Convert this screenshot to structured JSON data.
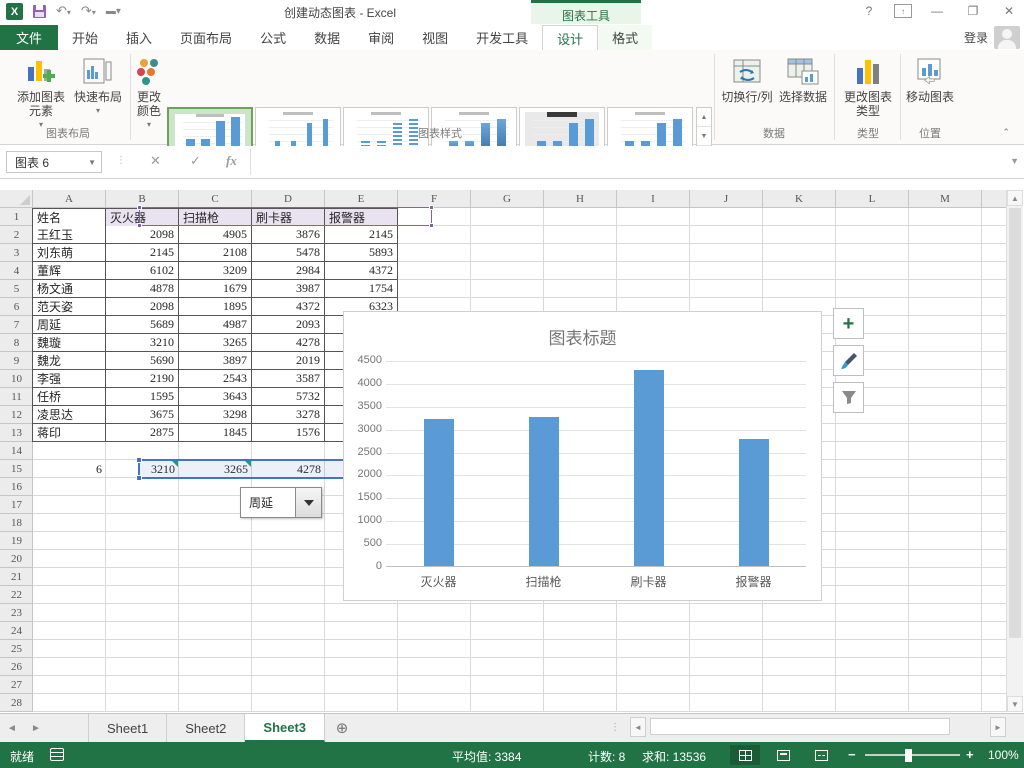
{
  "window": {
    "title": "创建动态图表 - Excel",
    "contextual_tool": "图表工具",
    "signin": "登录"
  },
  "tabs": {
    "file": "文件",
    "main": [
      "开始",
      "插入",
      "页面布局",
      "公式",
      "数据",
      "审阅",
      "视图",
      "开发工具"
    ],
    "contextual": [
      "设计",
      "格式"
    ],
    "active_contextual": "设计"
  },
  "ribbon": {
    "add_element": "添加图表元素",
    "quick_layout": "快速布局",
    "group_layout": "图表布局",
    "change_colors": "更改颜色",
    "group_styles": "图表样式",
    "switch_rowcol": "切换行/列",
    "select_data": "选择数据",
    "group_data": "数据",
    "change_type": "更改图表类型",
    "group_type": "类型",
    "move_chart": "移动图表",
    "group_location": "位置"
  },
  "formula_bar": {
    "name_box": "图表 6",
    "formula": ""
  },
  "grid": {
    "columns": [
      "A",
      "B",
      "C",
      "D",
      "E",
      "F",
      "G",
      "H",
      "I",
      "J",
      "K",
      "L",
      "M"
    ],
    "row_count": 28,
    "table": {
      "headers": [
        "姓名",
        "灭火器",
        "扫描枪",
        "刷卡器",
        "报警器"
      ],
      "rows": [
        [
          "王红玉",
          "2098",
          "4905",
          "3876",
          "2145"
        ],
        [
          "刘东萌",
          "2145",
          "2108",
          "5478",
          "5893"
        ],
        [
          "董辉",
          "6102",
          "3209",
          "2984",
          "4372"
        ],
        [
          "杨文通",
          "4878",
          "1679",
          "3987",
          "1754"
        ],
        [
          "范天姿",
          "2098",
          "1895",
          "4372",
          "6323"
        ],
        [
          "周延",
          "5689",
          "4987",
          "2093",
          ""
        ],
        [
          "魏璇",
          "3210",
          "3265",
          "4278",
          ""
        ],
        [
          "魏龙",
          "5690",
          "3897",
          "2019",
          ""
        ],
        [
          "李强",
          "2190",
          "2543",
          "3587",
          ""
        ],
        [
          "任桥",
          "1595",
          "3643",
          "5732",
          ""
        ],
        [
          "凌思达",
          "3675",
          "3298",
          "3278",
          ""
        ],
        [
          "蒋印",
          "2875",
          "1845",
          "1576",
          ""
        ]
      ],
      "row15": {
        "a": "6",
        "values": [
          "3210",
          "3265",
          "4278"
        ]
      }
    }
  },
  "combo": {
    "value": "周延"
  },
  "chart_data": {
    "type": "bar",
    "title": "图表标题",
    "categories": [
      "灭火器",
      "扫描枪",
      "刷卡器",
      "报警器"
    ],
    "values": [
      3210,
      3265,
      4278,
      2780
    ],
    "ylim": [
      0,
      4500
    ],
    "ytick_step": 500,
    "bar_color": "#5B9BD5",
    "grid": true,
    "legend": false
  },
  "sheets": {
    "tabs": [
      "Sheet1",
      "Sheet2",
      "Sheet3"
    ],
    "active": "Sheet3"
  },
  "status_bar": {
    "ready": "就绪",
    "average": "平均值: 3384",
    "count": "计数: 8",
    "sum": "求和: 13536",
    "zoom": "100%"
  },
  "colors": {
    "excel_green": "#217346",
    "bar_blue": "#5B9BD5",
    "category_purple": "#8064A2",
    "series_blue": "#4472C4"
  }
}
